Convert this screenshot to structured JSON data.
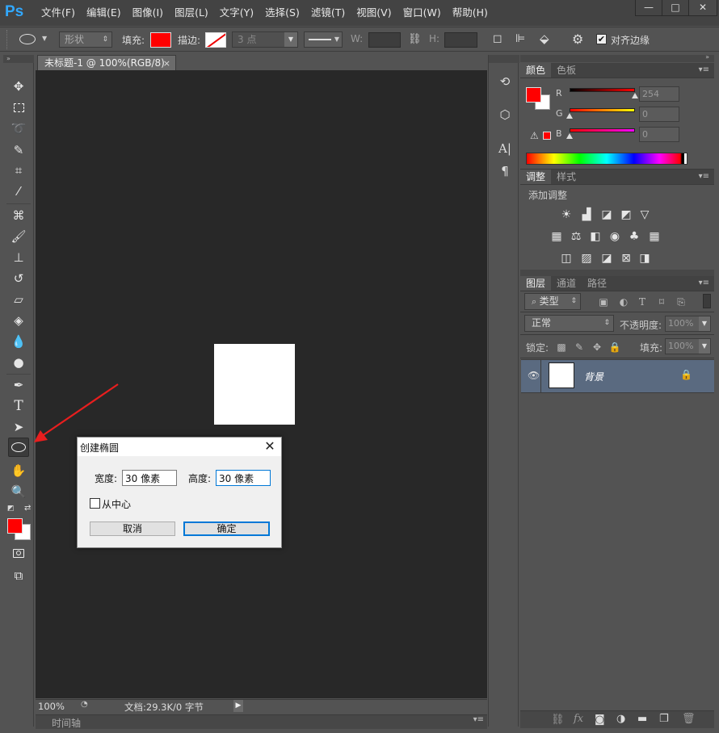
{
  "app": {
    "logo": "Ps",
    "menus": [
      "文件(F)",
      "编辑(E)",
      "图像(I)",
      "图层(L)",
      "文字(Y)",
      "选择(S)",
      "滤镜(T)",
      "视图(V)",
      "窗口(W)",
      "帮助(H)"
    ],
    "window_buttons": {
      "minimize": "—",
      "maximize": "□",
      "close": "✕"
    }
  },
  "options_bar": {
    "mode_value": "形状",
    "fill_label": "填充:",
    "stroke_label": "描边:",
    "stroke_size": "3 点",
    "width_label": "W:",
    "height_label": "H:",
    "align_edges_label": "对齐边缘",
    "align_edges_checked": true,
    "fill_color": "#ff0000"
  },
  "document": {
    "tab_title": "未标题-1 @ 100%(RGB/8)",
    "tab_close": "×",
    "zoom": "100%",
    "doc_info": "文档:29.3K/0 字节",
    "timeline_label": "时间轴"
  },
  "tools": {
    "foreground_color": "#ff0000",
    "background_color": "#ffffff"
  },
  "color_panel": {
    "tabs": [
      "颜色",
      "色板"
    ],
    "r_label": "R",
    "g_label": "G",
    "b_label": "B",
    "r_value": "254",
    "g_value": "0",
    "b_value": "0",
    "r_level": 1.0,
    "g_level": 0.0,
    "b_level": 0.0
  },
  "adjustments_panel": {
    "tabs": [
      "调整",
      "样式"
    ],
    "add_label": "添加调整"
  },
  "layers_panel": {
    "tabs": [
      "图层",
      "通道",
      "路径"
    ],
    "filter_kind": "类型",
    "blend_mode": "正常",
    "opacity_label": "不透明度:",
    "opacity_value": "100%",
    "lock_label": "锁定:",
    "fill_label": "填充:",
    "fill_value": "100%",
    "layers": [
      {
        "name": "背景"
      }
    ]
  },
  "dialog": {
    "title": "创建椭圆",
    "close": "✕",
    "width_label": "宽度:",
    "width_value": "30 像素",
    "height_label": "高度:",
    "height_value": "30 像素",
    "from_center_label": "从中心",
    "from_center_checked": false,
    "cancel_label": "取消",
    "ok_label": "确定"
  },
  "annotation": {
    "arrow_color": "#e81e1e"
  }
}
